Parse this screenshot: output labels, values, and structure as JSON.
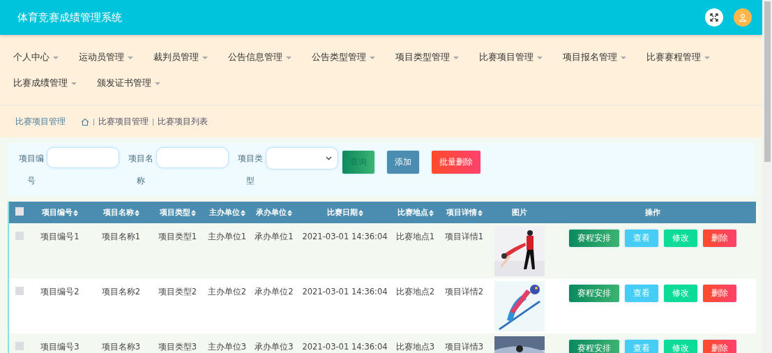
{
  "header": {
    "title": "体育竞赛成绩管理系统"
  },
  "nav": [
    {
      "label": "个人中心"
    },
    {
      "label": "运动员管理"
    },
    {
      "label": "裁判员管理"
    },
    {
      "label": "公告信息管理"
    },
    {
      "label": "公告类型管理"
    },
    {
      "label": "项目类型管理"
    },
    {
      "label": "比赛项目管理"
    },
    {
      "label": "项目报名管理"
    },
    {
      "label": "比赛赛程管理"
    },
    {
      "label": "比赛成绩管理"
    },
    {
      "label": "颁发证书管理"
    }
  ],
  "breadcrumb": {
    "title": "比赛项目管理",
    "path": [
      "比赛项目管理",
      "比赛项目列表"
    ]
  },
  "search": {
    "fields": [
      {
        "label": "项目编号",
        "kind": "input"
      },
      {
        "label": "项目名称",
        "kind": "input"
      },
      {
        "label": "项目类型",
        "kind": "select"
      }
    ],
    "buttons": [
      {
        "label": "查询",
        "kind": "query"
      },
      {
        "label": "添加",
        "kind": "add"
      },
      {
        "label": "批量删除",
        "kind": "delete"
      }
    ]
  },
  "table": {
    "select_all": {
      "checked": false
    },
    "columns": [
      {
        "label": "项目编号",
        "sortable": true
      },
      {
        "label": "项目名称",
        "sortable": true
      },
      {
        "label": "项目类型",
        "sortable": true
      },
      {
        "label": "主办单位",
        "sortable": true
      },
      {
        "label": "承办单位",
        "sortable": true
      },
      {
        "label": "比赛日期",
        "sortable": true
      },
      {
        "label": "比赛地点",
        "sortable": true
      },
      {
        "label": "项目详情",
        "sortable": true
      },
      {
        "label": "图片",
        "sortable": false
      },
      {
        "label": "操作",
        "sortable": false
      }
    ],
    "rows": [
      {
        "checked": false,
        "cells": [
          "项目编号1",
          "项目名称1",
          "项目类型1",
          "主办单位1",
          "承办单位1",
          "2021-03-01 14:36:04",
          "比赛地点1",
          "项目详情1"
        ],
        "actions": [
          {
            "label": "赛程安排",
            "kind": "schedule"
          },
          {
            "label": "查看",
            "kind": "view"
          },
          {
            "label": "修改",
            "kind": "edit"
          },
          {
            "label": "删除",
            "kind": "delete"
          }
        ]
      },
      {
        "checked": false,
        "cells": [
          "项目编号2",
          "项目名称2",
          "项目类型2",
          "主办单位2",
          "承办单位2",
          "2021-03-01 14:36:04",
          "比赛地点2",
          "项目详情2"
        ],
        "actions": [
          {
            "label": "赛程安排",
            "kind": "schedule"
          },
          {
            "label": "查看",
            "kind": "view"
          },
          {
            "label": "修改",
            "kind": "edit"
          },
          {
            "label": "删除",
            "kind": "delete"
          }
        ]
      },
      {
        "checked": false,
        "cells": [
          "项目编号3",
          "项目名称3",
          "项目类型3",
          "主办单位3",
          "承办单位3",
          "2021-03-01 14:36:04",
          "比赛地点3",
          "项目详情3"
        ],
        "actions": [
          {
            "label": "赛程安排",
            "kind": "schedule"
          },
          {
            "label": "查看",
            "kind": "view"
          },
          {
            "label": "修改",
            "kind": "edit"
          },
          {
            "label": "删除",
            "kind": "delete"
          }
        ]
      }
    ]
  }
}
